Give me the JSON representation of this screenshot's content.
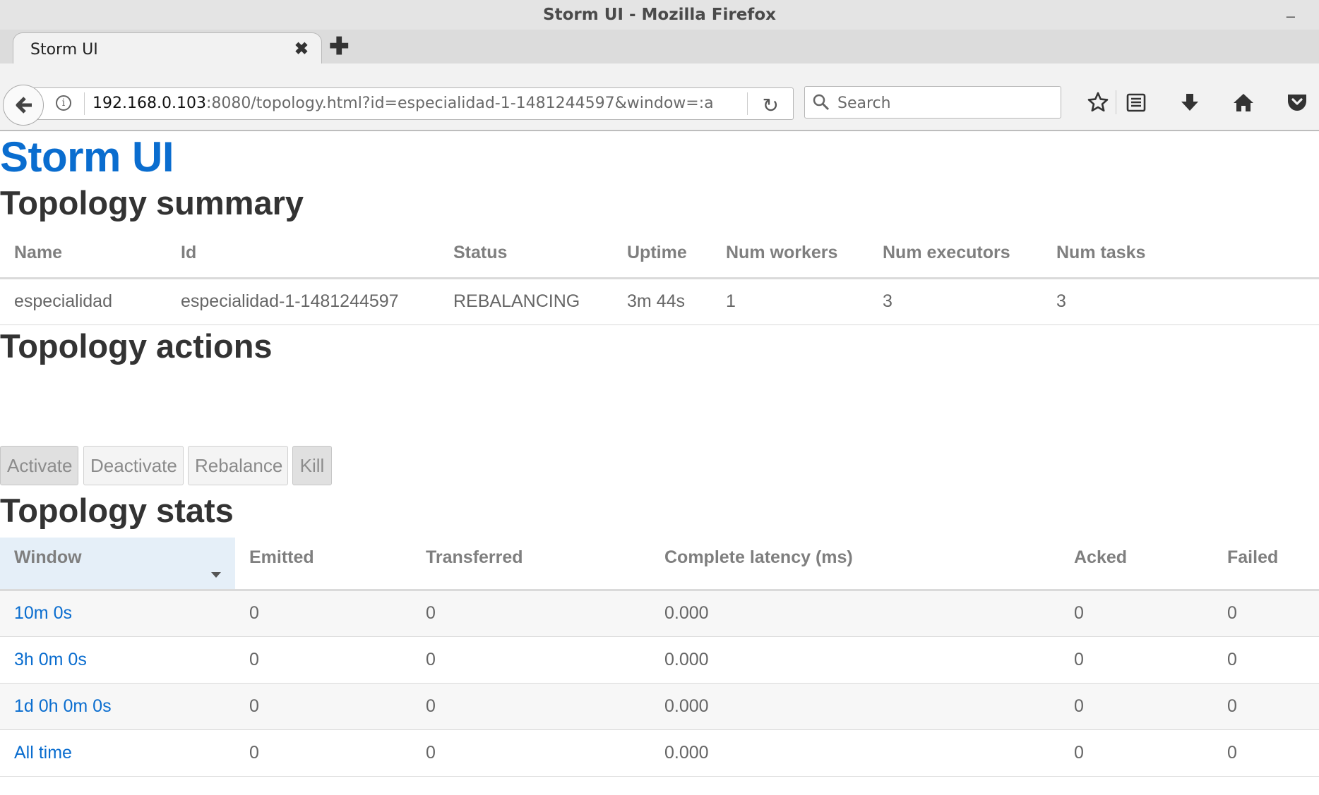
{
  "window": {
    "title": "Storm UI - Mozilla Firefox",
    "minimize": "–"
  },
  "browser": {
    "tab_label": "Storm UI",
    "tab_close": "✖",
    "new_tab": "✚",
    "url_host": "192.168.0.103",
    "url_rest": ":8080/topology.html?id=especialidad-1-1481244597&window=:a",
    "search_placeholder": "Search",
    "icons": [
      "back-arrow-icon",
      "info-icon",
      "reload-icon",
      "search-icon",
      "bookmark-star-icon",
      "reading-list-icon",
      "download-icon",
      "home-icon",
      "pocket-icon"
    ]
  },
  "page": {
    "app_title": "Storm UI",
    "summary": {
      "heading": "Topology summary",
      "columns": [
        "Name",
        "Id",
        "Status",
        "Uptime",
        "Num workers",
        "Num executors",
        "Num tasks"
      ],
      "row": {
        "name": "especialidad",
        "id": "especialidad-1-1481244597",
        "status": "REBALANCING",
        "uptime": "3m 44s",
        "num_workers": "1",
        "num_executors": "3",
        "num_tasks": "3"
      }
    },
    "actions": {
      "heading": "Topology actions",
      "activate": "Activate",
      "deactivate": "Deactivate",
      "rebalance": "Rebalance",
      "kill": "Kill"
    },
    "stats": {
      "heading": "Topology stats",
      "columns": [
        "Window",
        "Emitted",
        "Transferred",
        "Complete latency (ms)",
        "Acked",
        "Failed"
      ],
      "rows": [
        {
          "window": "10m 0s",
          "emitted": "0",
          "transferred": "0",
          "latency": "0.000",
          "acked": "0",
          "failed": "0"
        },
        {
          "window": "3h 0m 0s",
          "emitted": "0",
          "transferred": "0",
          "latency": "0.000",
          "acked": "0",
          "failed": "0"
        },
        {
          "window": "1d 0h 0m 0s",
          "emitted": "0",
          "transferred": "0",
          "latency": "0.000",
          "acked": "0",
          "failed": "0"
        },
        {
          "window": "All time",
          "emitted": "0",
          "transferred": "0",
          "latency": "0.000",
          "acked": "0",
          "failed": "0"
        }
      ]
    }
  },
  "colors": {
    "link": "#0a6dcf",
    "heading": "#333333",
    "sorted_header_bg": "#e5eff8"
  }
}
